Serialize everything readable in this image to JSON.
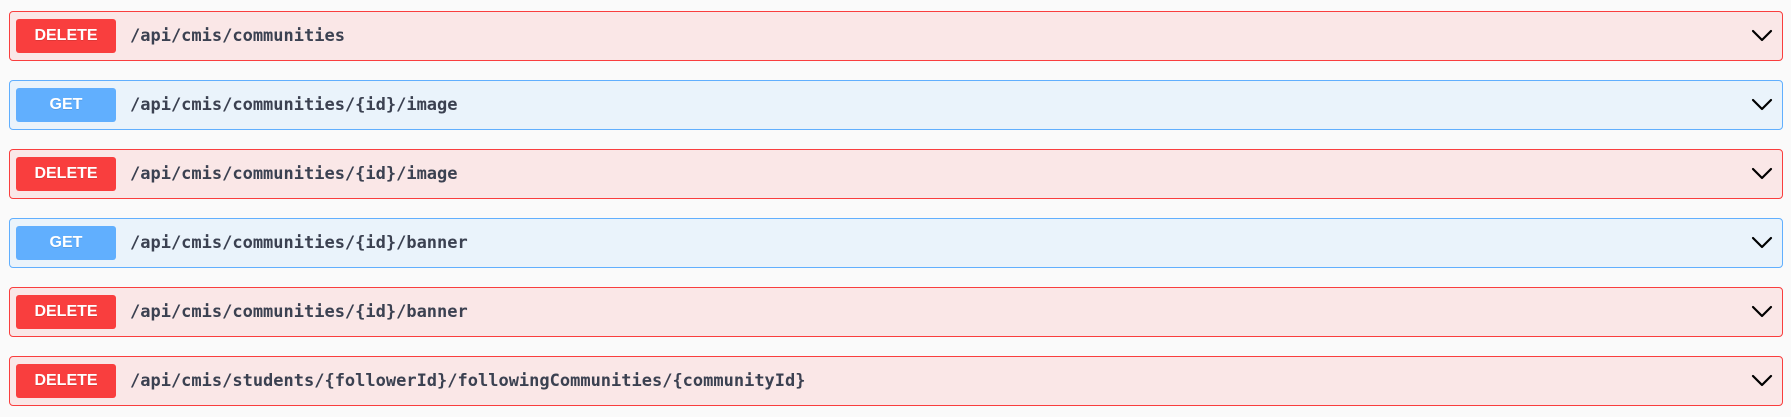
{
  "operations": [
    {
      "method": "DELETE",
      "path": "/api/cmis/communities"
    },
    {
      "method": "GET",
      "path": "/api/cmis/communities/{id}/image"
    },
    {
      "method": "DELETE",
      "path": "/api/cmis/communities/{id}/image"
    },
    {
      "method": "GET",
      "path": "/api/cmis/communities/{id}/banner"
    },
    {
      "method": "DELETE",
      "path": "/api/cmis/communities/{id}/banner"
    },
    {
      "method": "DELETE",
      "path": "/api/cmis/students/{followerId}/followingCommunities/{communityId}"
    }
  ],
  "icons": {
    "expand": "chevron-down-icon"
  },
  "colors": {
    "delete_accent": "#f93e3e",
    "delete_bg": "#fae7e7",
    "get_accent": "#61affe",
    "get_bg": "#eaf3fb",
    "path_text": "#3b4151"
  }
}
